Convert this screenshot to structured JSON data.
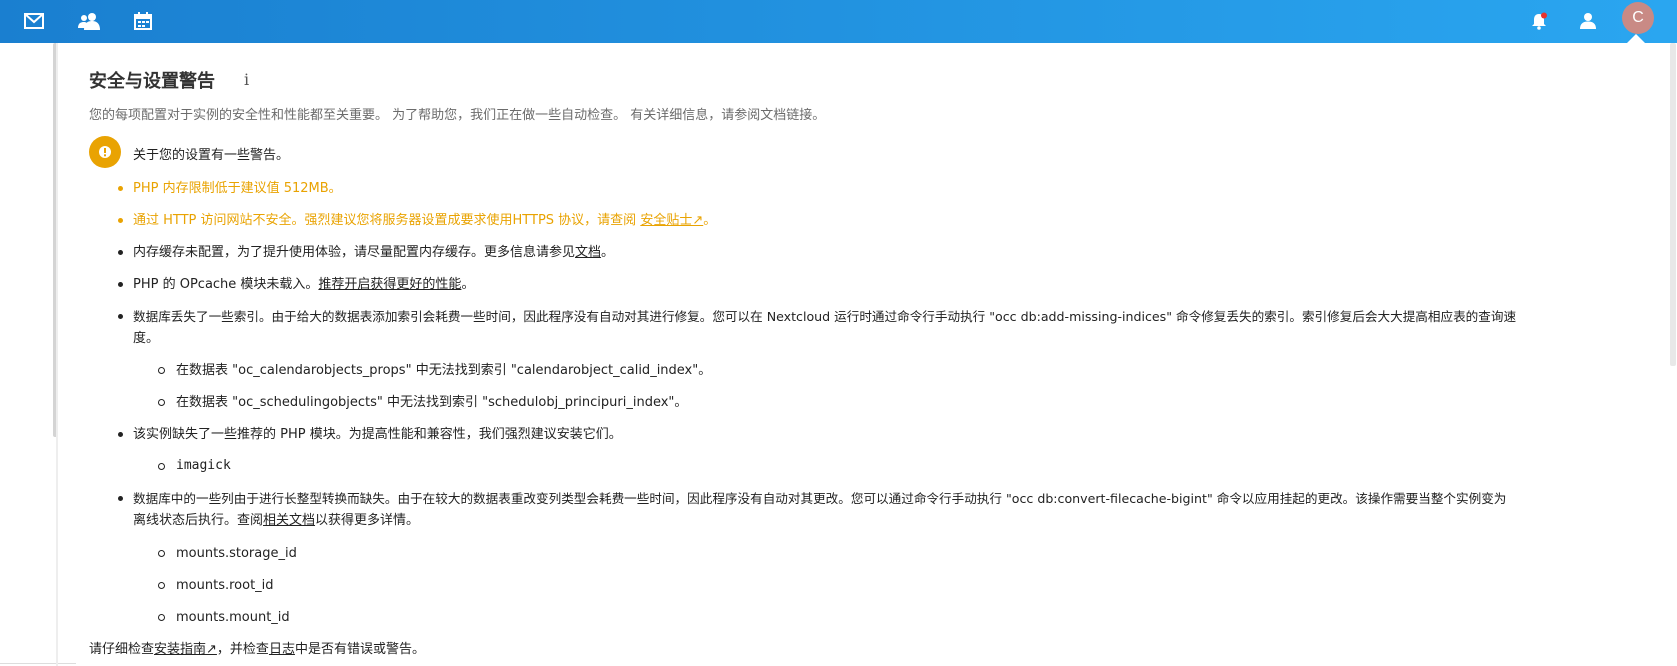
{
  "topbar": {
    "icons": [
      "mail-icon",
      "contacts-icon",
      "calendar-icon"
    ],
    "right_icons": [
      "notifications-icon",
      "contacts-menu-icon"
    ],
    "avatar_letter": "C",
    "colors": {
      "start": "#1a7fd0",
      "end": "#2aa6f0"
    }
  },
  "section": {
    "title": "安全与设置警告",
    "info": "i",
    "description": "您的每项配置对于实例的安全性和性能都至关重要。 为了帮助您，我们正在做一些自动检查。 有关详细信息，请参阅文档链接。",
    "warning_header": "关于您的设置有一些警告。"
  },
  "items": {
    "php_mem": "PHP 内存限制低于建议值 512MB。",
    "https_pre": "通过 HTTP 访问网站不安全。强烈建议您将服务器设置成要求使用HTTPS 协议，请查阅 ",
    "https_link": "安全贴士↗",
    "https_post": "。",
    "memcache_pre": "内存缓存未配置，为了提升使用体验，请尽量配置内存缓存。更多信息请参见",
    "memcache_link": "文档",
    "memcache_post": "。",
    "opcache_pre": "PHP 的 OPcache 模块未载入。",
    "opcache_link": "推荐开启获得更好的性能",
    "opcache_post": "。",
    "indices_line1": "数据库丢失了一些索引。由于给大的数据表添加索引会耗费一些时间，因此程序没有自动对其进行修复。您可以在 Nextcloud 运行时通过命令行手动执行 \"occ db:add-missing-indices\" 命令修复丢失的索引。索引修复后会大大提高相应表的查询速",
    "indices_line2": "度。",
    "index1": "在数据表 \"oc_calendarobjects_props\" 中无法找到索引 \"calendarobject_calid_index\"。",
    "index2": "在数据表 \"oc_schedulingobjects\" 中无法找到索引 \"schedulobj_principuri_index\"。",
    "modules": "该实例缺失了一些推荐的 PHP 模块。为提高性能和兼容性，我们强烈建议安装它们。",
    "module1": "imagick",
    "bigint_line1": "数据库中的一些列由于进行长整型转换而缺失。由于在较大的数据表重改变列类型会耗费一些时间，因此程序没有自动对其更改。您可以通过命令行手动执行 \"occ db:convert-filecache-bigint\" 命令以应用挂起的更改。该操作需要当整个实例变为",
    "bigint_line2_pre": "离线状态后执行。查阅",
    "bigint_line2_link": "相关文档",
    "bigint_line2_post": "以获得更多详情。",
    "col1": "mounts.storage_id",
    "col2": "mounts.root_id",
    "col3": "mounts.mount_id"
  },
  "footer": {
    "pre": "请仔细检查",
    "link1": "安装指南↗",
    "mid": "，并检查",
    "link2": "日志",
    "post": "中是否有错误或警告。"
  },
  "colors": {
    "warning": "#e9a302"
  }
}
